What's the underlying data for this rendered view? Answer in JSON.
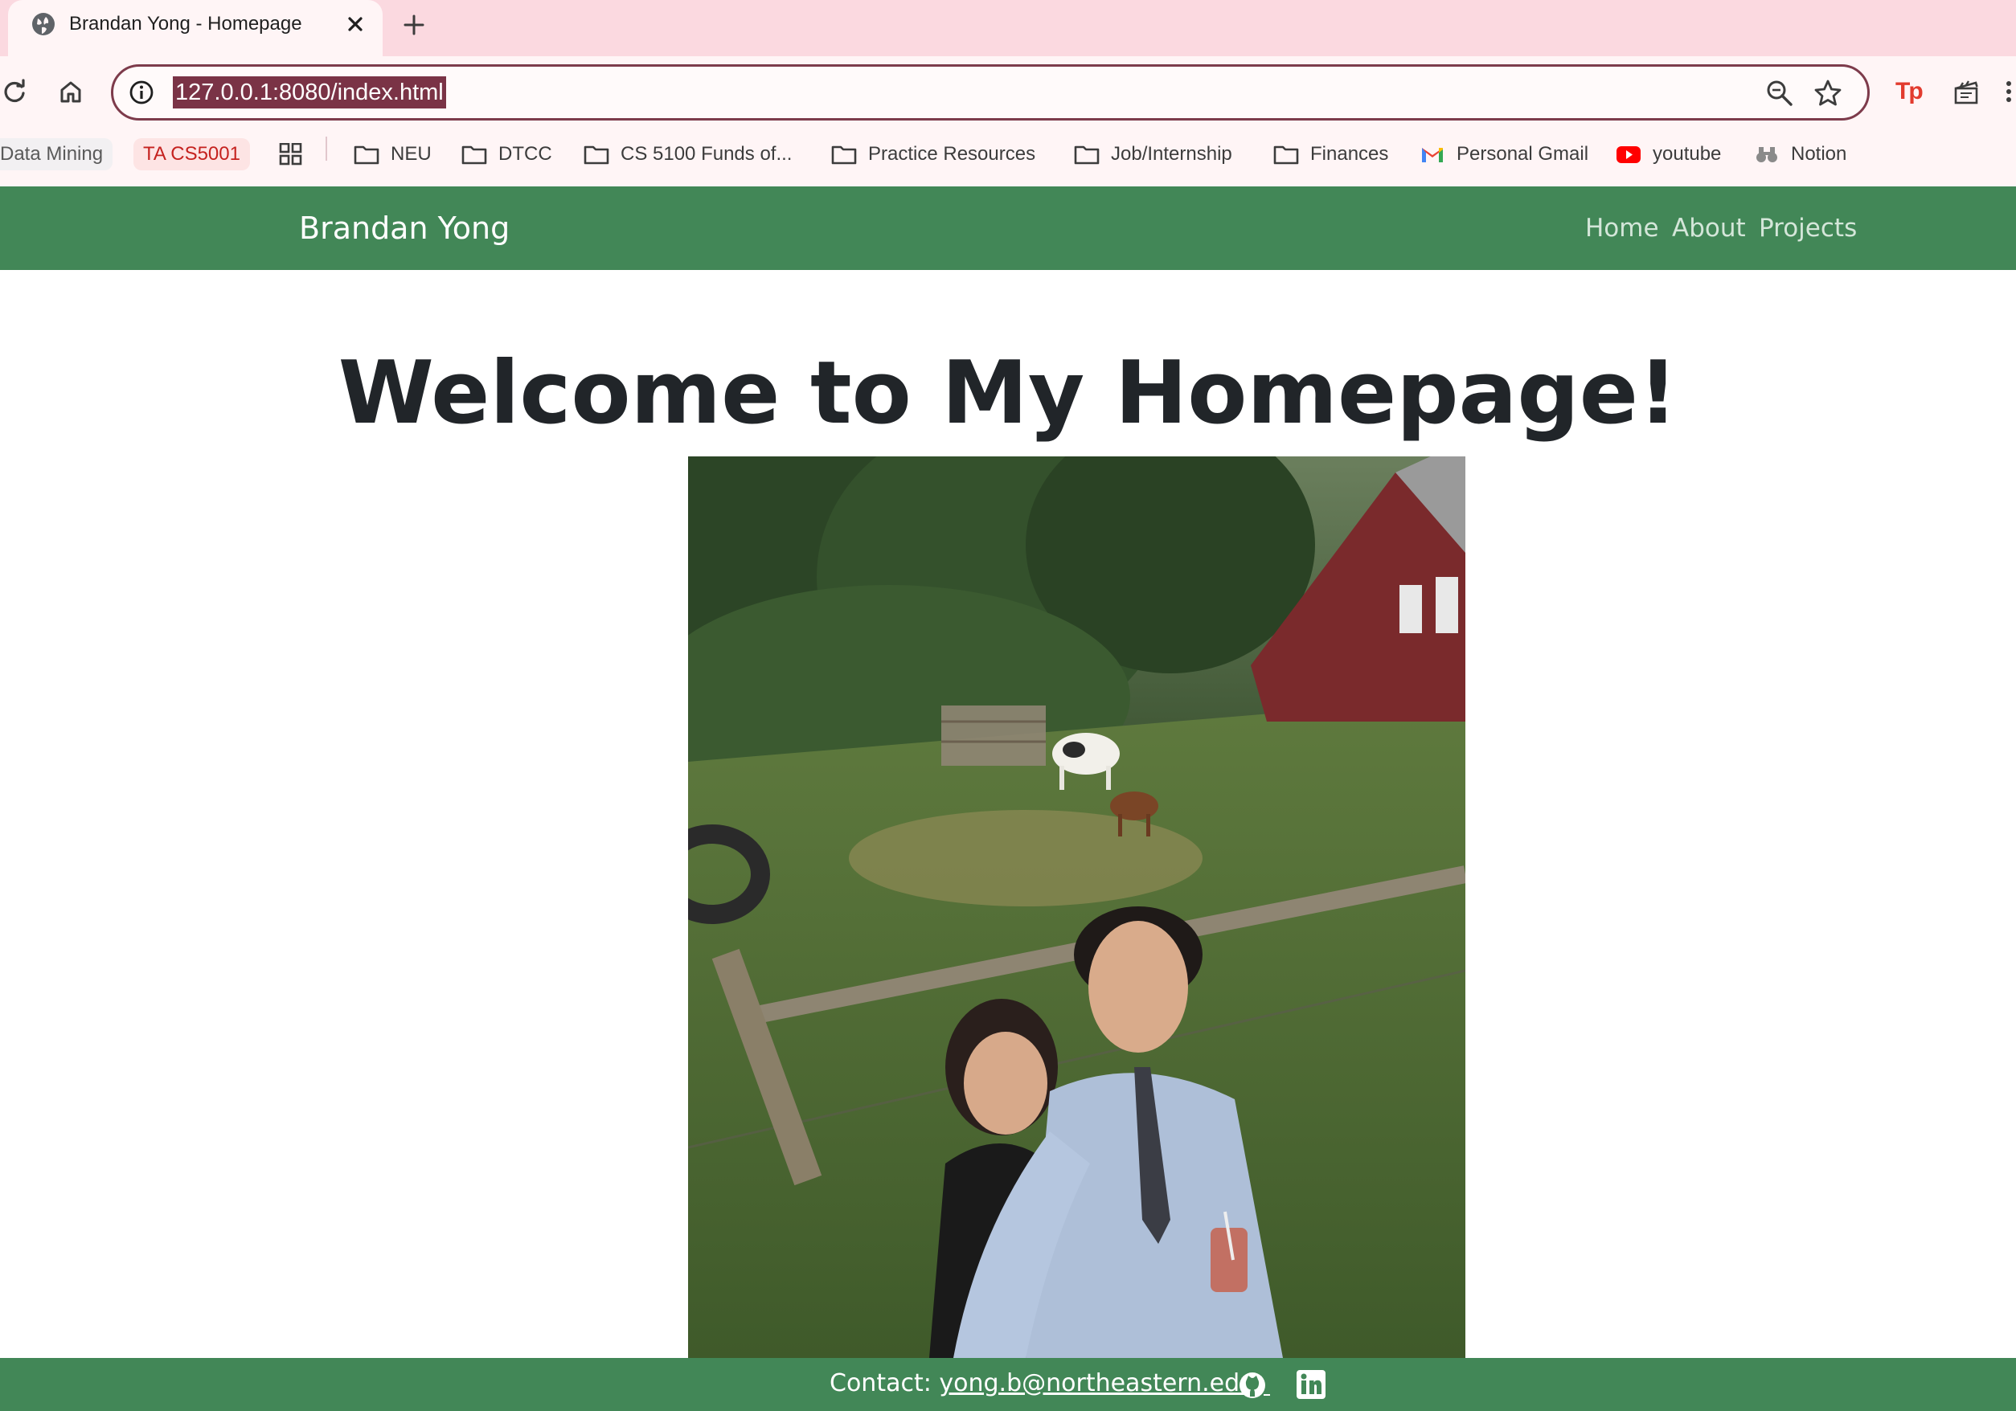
{
  "browser": {
    "tab": {
      "title": "Brandan Yong - Homepage",
      "favicon": "globe-icon"
    },
    "address_bar": {
      "url": "127.0.0.1:8080/index.html"
    },
    "toolbar_icons": [
      "reload-icon",
      "home-icon",
      "site-info-icon",
      "zoom-icon",
      "bookmark-star-icon",
      "extension-tp-icon",
      "extension-clapper-icon"
    ],
    "extension_tp_label": "Tp",
    "bookmarks": [
      {
        "label": "Data Mining",
        "icon": "none"
      },
      {
        "label": "TA CS5001",
        "icon": "none"
      },
      {
        "label": "",
        "icon": "apps-grid-icon"
      },
      {
        "label": "NEU",
        "icon": "folder-icon"
      },
      {
        "label": "DTCC",
        "icon": "folder-icon"
      },
      {
        "label": "CS 5100 Funds of...",
        "icon": "folder-icon"
      },
      {
        "label": "Practice Resources",
        "icon": "folder-icon"
      },
      {
        "label": "Job/Internship",
        "icon": "folder-icon"
      },
      {
        "label": "Finances",
        "icon": "folder-icon"
      },
      {
        "label": "Personal Gmail",
        "icon": "gmail-icon"
      },
      {
        "label": "youtube",
        "icon": "youtube-icon"
      },
      {
        "label": "Notion",
        "icon": "binoculars-icon"
      }
    ]
  },
  "page": {
    "navbar": {
      "brand": "Brandan Yong",
      "links": [
        "Home",
        "About",
        "Projects"
      ]
    },
    "heading": "Welcome to My Homepage!",
    "photo": {
      "subject": "selfie-at-farm-photo"
    },
    "footer": {
      "contact_label": "Contact:",
      "email": "yong.b@northeastern.edu",
      "icons": [
        "github-icon",
        "linkedin-icon"
      ]
    }
  },
  "colors": {
    "brand_green": "#428757",
    "tab_strip": "#fbd9e0",
    "url_highlight": "#7a3346",
    "heading_text": "#212529"
  }
}
